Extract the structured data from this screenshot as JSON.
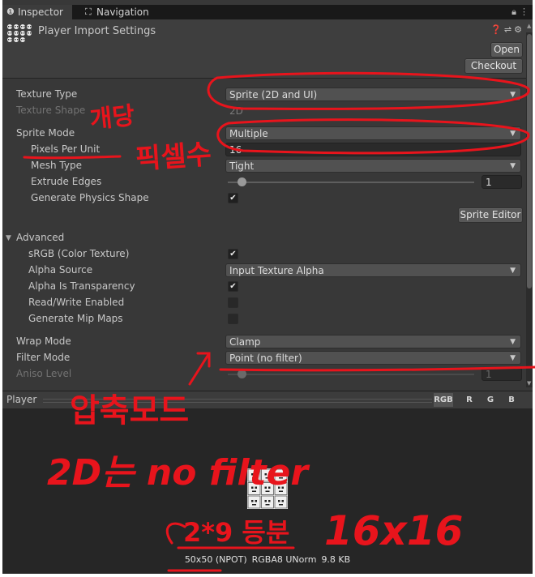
{
  "tabs": [
    {
      "label": "Inspector",
      "icon": "info-icon"
    },
    {
      "label": "Navigation",
      "icon": "navigation-icon"
    }
  ],
  "header": {
    "title": "Player Import Settings",
    "open_label": "Open",
    "checkout_label": "Checkout"
  },
  "props": {
    "texture_type": {
      "label": "Texture Type",
      "value": "Sprite (2D and UI)"
    },
    "texture_shape": {
      "label": "Texture Shape",
      "value": "2D"
    },
    "sprite_mode": {
      "label": "Sprite Mode",
      "value": "Multiple"
    },
    "pixels_per_unit": {
      "label": "Pixels Per Unit",
      "value": "16"
    },
    "mesh_type": {
      "label": "Mesh Type",
      "value": "Tight"
    },
    "extrude_edges": {
      "label": "Extrude Edges",
      "value": "1",
      "level": 0.0
    },
    "generate_physics": {
      "label": "Generate Physics Shape",
      "checked": true
    },
    "sprite_editor_label": "Sprite Editor",
    "advanced": {
      "label": "Advanced"
    },
    "srgb": {
      "label": "sRGB (Color Texture)",
      "checked": true
    },
    "alpha_source": {
      "label": "Alpha Source",
      "value": "Input Texture Alpha"
    },
    "alpha_transparency": {
      "label": "Alpha Is Transparency",
      "checked": true
    },
    "read_write": {
      "label": "Read/Write Enabled",
      "checked": false
    },
    "mipmaps": {
      "label": "Generate Mip Maps",
      "checked": false
    },
    "wrap_mode": {
      "label": "Wrap Mode",
      "value": "Clamp"
    },
    "filter_mode": {
      "label": "Filter Mode",
      "value": "Point (no filter)"
    },
    "aniso_level": {
      "label": "Aniso Level",
      "value": "1",
      "level": 0.0
    }
  },
  "preview": {
    "title": "Player",
    "channels": [
      "RGB",
      "R",
      "G",
      "B"
    ],
    "size": "50x50 (NPOT)",
    "format": "RGBA8 UNorm",
    "filesize": "9.8 KB"
  },
  "annotations": {
    "per_tile": "개당",
    "pixel_count": "픽셀수",
    "compression_mode": "압축모드",
    "no_filter_note": "2D는 no filter",
    "split_note": "2*9 등분",
    "tile_size": "16x16"
  },
  "colors": {
    "annotation": "#e8141c",
    "panel_bg": "#383838"
  }
}
